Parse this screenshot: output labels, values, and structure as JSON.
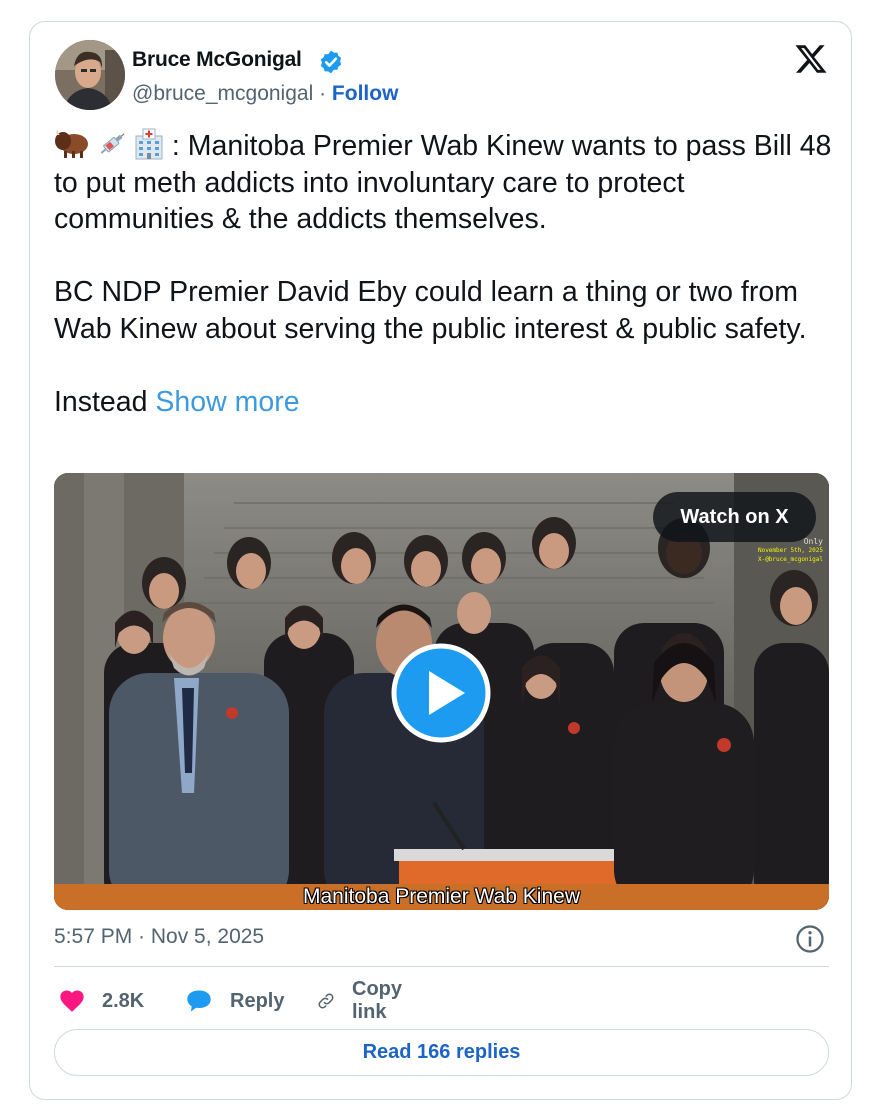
{
  "author": {
    "display_name": "Bruce McGonigal",
    "handle": "@bruce_mcgonigal",
    "separator": " · ",
    "follow_label": "Follow",
    "verified": true
  },
  "tweet": {
    "emojis": [
      "bison-emoji",
      "syringe-emoji",
      "hospital-emoji"
    ],
    "paragraph1": " : Manitoba Premier Wab Kinew wants to pass Bill 48 to put meth addicts into involuntary care to protect communities & the addicts themselves.",
    "paragraph2": "BC NDP Premier David Eby could learn a thing or two from Wab Kinew about serving the public interest & public safety.",
    "paragraph3": "Instead",
    "show_more": "Show more"
  },
  "media": {
    "watch_label": "Watch on X",
    "caption": "Manitoba Premier Wab Kinew",
    "watermark_lines": [
      "Only",
      "November 5th, 2025",
      "X-@bruce_mcgonigal"
    ]
  },
  "meta": {
    "timestamp": "5:57 PM · Nov 5, 2025"
  },
  "actions": {
    "likes": "2.8K",
    "reply_label": "Reply",
    "copy_label": "Copy link",
    "read_replies": "Read 166 replies"
  },
  "colors": {
    "link": "#1d64c8",
    "show_more": "#3b9ae0",
    "like_heart": "#f91880",
    "reply_bubble": "#1d9bf0",
    "verified": "#1d9bf0",
    "muted": "#536471",
    "caption_bar": "#c96f28"
  }
}
